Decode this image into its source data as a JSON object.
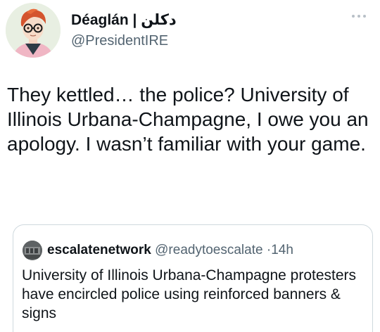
{
  "author": {
    "display_name": "Déaglán | دكلن",
    "handle": "@PresidentIRE"
  },
  "tweet": {
    "text": "They kettled… the police? University of Illinois Urbana-Champagne, I owe you an apology. I wasn’t familiar with your game."
  },
  "quoted_tweet": {
    "display_name": "escalatenetwork",
    "handle": "@readytoescalate",
    "separator": "·",
    "time": "14h",
    "text": "University of Illinois Urbana-Champagne protesters have encircled police using reinforced banners & signs"
  },
  "icons": {
    "avatar": "user-avatar-illustration",
    "more": "more-options-icon",
    "quote_avatar": "quoted-user-avatar"
  }
}
